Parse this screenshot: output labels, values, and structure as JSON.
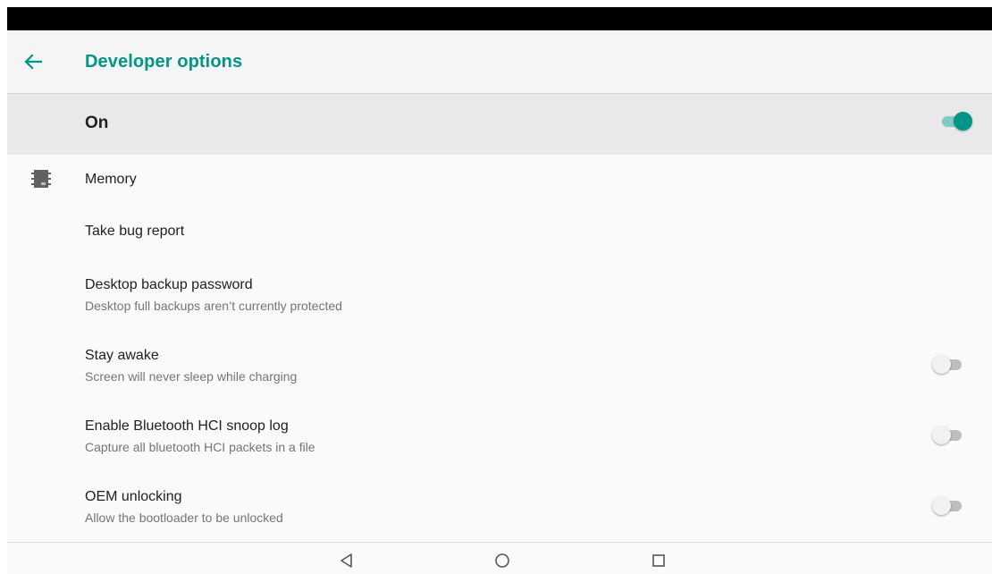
{
  "app_bar": {
    "title": "Developer options",
    "back_icon": "arrow-back-icon"
  },
  "master_switch": {
    "label": "On",
    "checked": true
  },
  "colors": {
    "accent": "#009688",
    "accent_light": "#80cbc4",
    "summary_text": "#757575"
  },
  "items": [
    {
      "title": "Memory",
      "icon": "memory-chip-icon"
    },
    {
      "title": "Take bug report"
    },
    {
      "title": "Desktop backup password",
      "summary": "Desktop full backups aren’t currently protected"
    },
    {
      "title": "Stay awake",
      "summary": "Screen will never sleep while charging",
      "checked": false
    },
    {
      "title": "Enable Bluetooth HCI snoop log",
      "summary": "Capture all bluetooth HCI packets in a file",
      "checked": false
    },
    {
      "title": "OEM unlocking",
      "summary": "Allow the bootloader to be unlocked",
      "checked": false
    }
  ],
  "nav_bar": {
    "buttons": [
      "back-icon",
      "home-icon",
      "recents-icon"
    ]
  }
}
